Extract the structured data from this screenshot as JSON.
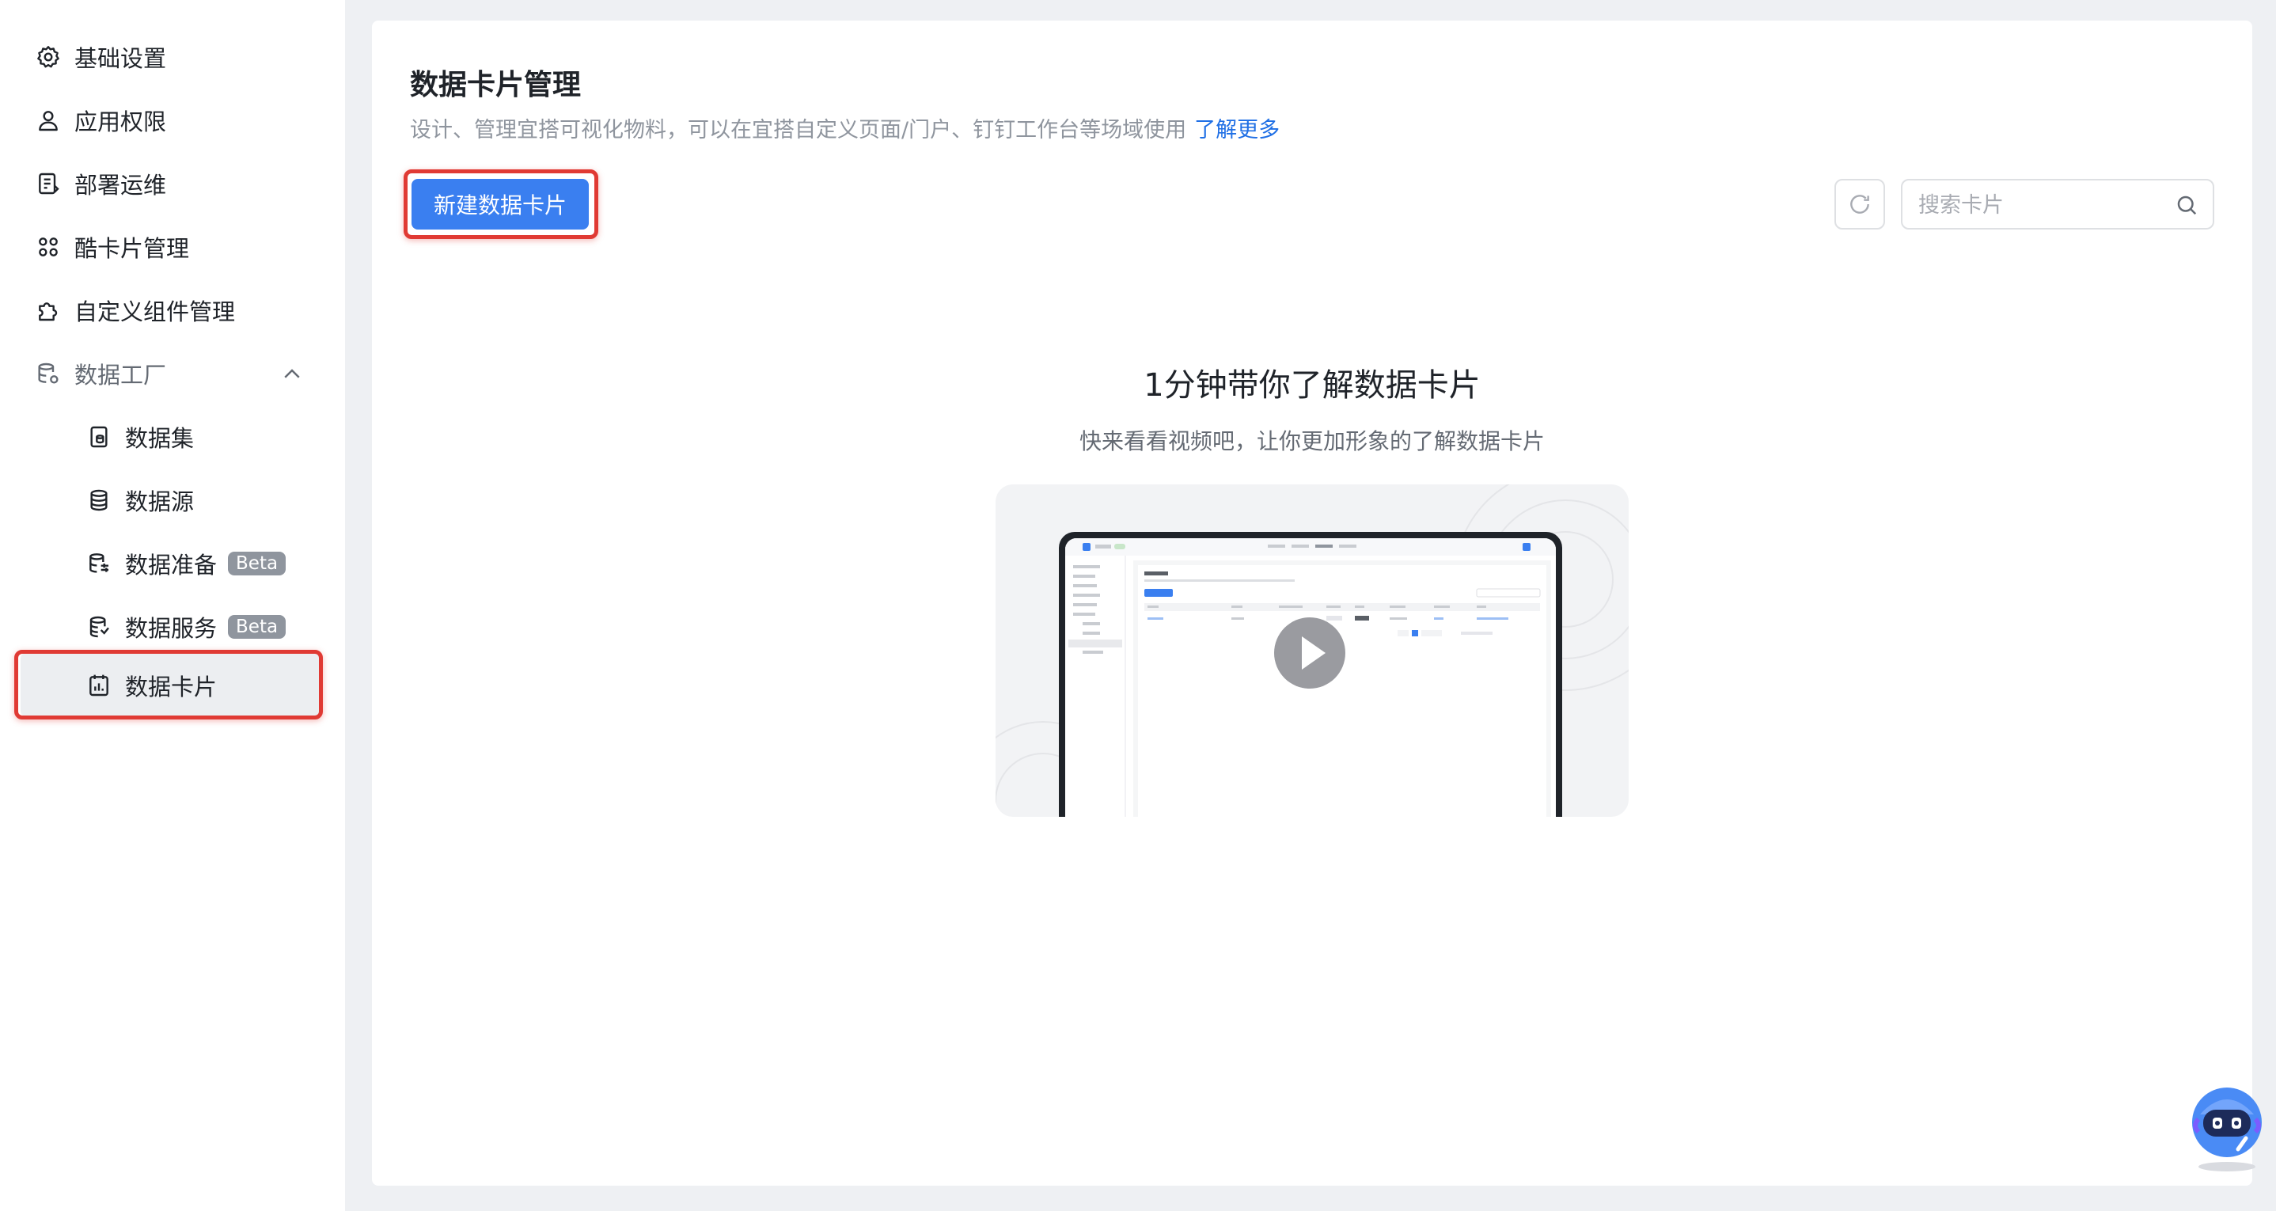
{
  "sidebar": {
    "items": [
      {
        "label": "基础设置",
        "icon": "gear-icon"
      },
      {
        "label": "应用权限",
        "icon": "user-icon"
      },
      {
        "label": "部署运维",
        "icon": "deploy-icon"
      },
      {
        "label": "酷卡片管理",
        "icon": "grid-icon"
      },
      {
        "label": "自定义组件管理",
        "icon": "puzzle-icon"
      },
      {
        "label": "数据工厂",
        "icon": "database-settings-icon",
        "expanded": true
      }
    ],
    "sub_items": [
      {
        "label": "数据集",
        "icon": "dataset-icon"
      },
      {
        "label": "数据源",
        "icon": "database-icon"
      },
      {
        "label": "数据准备",
        "icon": "data-prep-icon",
        "badge": "Beta"
      },
      {
        "label": "数据服务",
        "icon": "data-service-icon",
        "badge": "Beta"
      },
      {
        "label": "数据卡片",
        "icon": "chart-card-icon",
        "active": true
      }
    ]
  },
  "main": {
    "title": "数据卡片管理",
    "description": "设计、管理宜搭可视化物料，可以在宜搭自定义页面/门户、钉钉工作台等场域使用",
    "learn_more": "了解更多",
    "new_button": "新建数据卡片",
    "search_placeholder": "搜索卡片",
    "empty": {
      "title": "1分钟带你了解数据卡片",
      "subtitle": "快来看看视频吧，让你更加形象的了解数据卡片"
    }
  },
  "colors": {
    "accent": "#3a7ff0",
    "link": "#1f6fe5",
    "highlight_box": "#e03a34",
    "badge": "#8f959e"
  }
}
